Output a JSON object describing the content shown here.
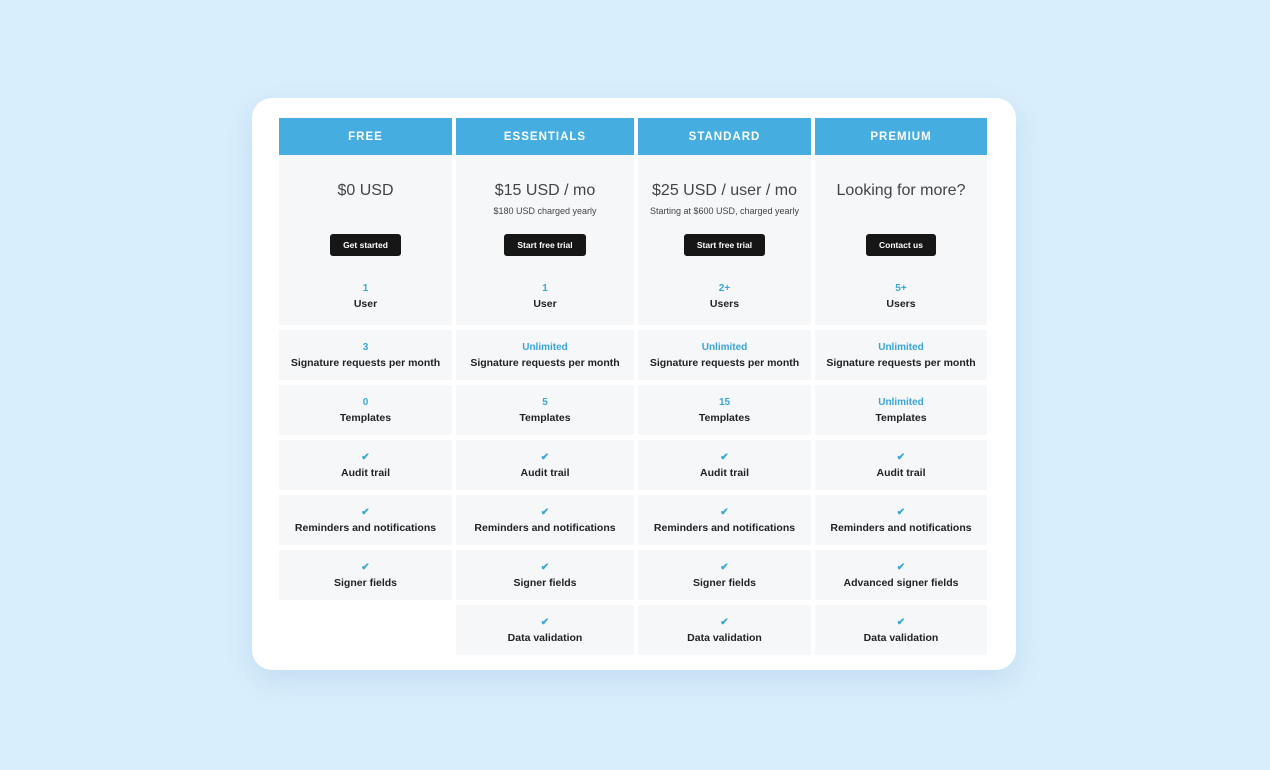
{
  "accent": "#45ade0",
  "plans": [
    {
      "name": "FREE",
      "price": "$0 USD",
      "note": "",
      "button": "Get started",
      "users_value": "1",
      "users_label": "User",
      "features": [
        {
          "value": "3",
          "label": "Signature requests per month"
        },
        {
          "value": "0",
          "label": "Templates"
        },
        {
          "value": "check",
          "label": "Audit trail"
        },
        {
          "value": "check",
          "label": "Reminders and notifications"
        },
        {
          "value": "check",
          "label": "Signer fields"
        },
        null
      ]
    },
    {
      "name": "ESSENTIALS",
      "price": "$15 USD / mo",
      "note": "$180 USD charged yearly",
      "button": "Start free trial",
      "users_value": "1",
      "users_label": "User",
      "features": [
        {
          "value": "Unlimited",
          "label": "Signature requests per month"
        },
        {
          "value": "5",
          "label": "Templates"
        },
        {
          "value": "check",
          "label": "Audit trail"
        },
        {
          "value": "check",
          "label": "Reminders and notifications"
        },
        {
          "value": "check",
          "label": "Signer fields"
        },
        {
          "value": "check",
          "label": "Data validation"
        }
      ]
    },
    {
      "name": "STANDARD",
      "price": "$25 USD / user / mo",
      "note": "Starting at $600 USD, charged yearly",
      "button": "Start free trial",
      "users_value": "2+",
      "users_label": "Users",
      "features": [
        {
          "value": "Unlimited",
          "label": "Signature requests per month"
        },
        {
          "value": "15",
          "label": "Templates"
        },
        {
          "value": "check",
          "label": "Audit trail"
        },
        {
          "value": "check",
          "label": "Reminders and notifications"
        },
        {
          "value": "check",
          "label": "Signer fields"
        },
        {
          "value": "check",
          "label": "Data validation"
        }
      ]
    },
    {
      "name": "PREMIUM",
      "price": "Looking for more?",
      "note": "",
      "button": "Contact us",
      "users_value": "5+",
      "users_label": "Users",
      "features": [
        {
          "value": "Unlimited",
          "label": "Signature requests per month"
        },
        {
          "value": "Unlimited",
          "label": "Templates"
        },
        {
          "value": "check",
          "label": "Audit trail"
        },
        {
          "value": "check",
          "label": "Reminders and notifications"
        },
        {
          "value": "check",
          "label": "Advanced signer fields"
        },
        {
          "value": "check",
          "label": "Data validation"
        }
      ]
    }
  ]
}
